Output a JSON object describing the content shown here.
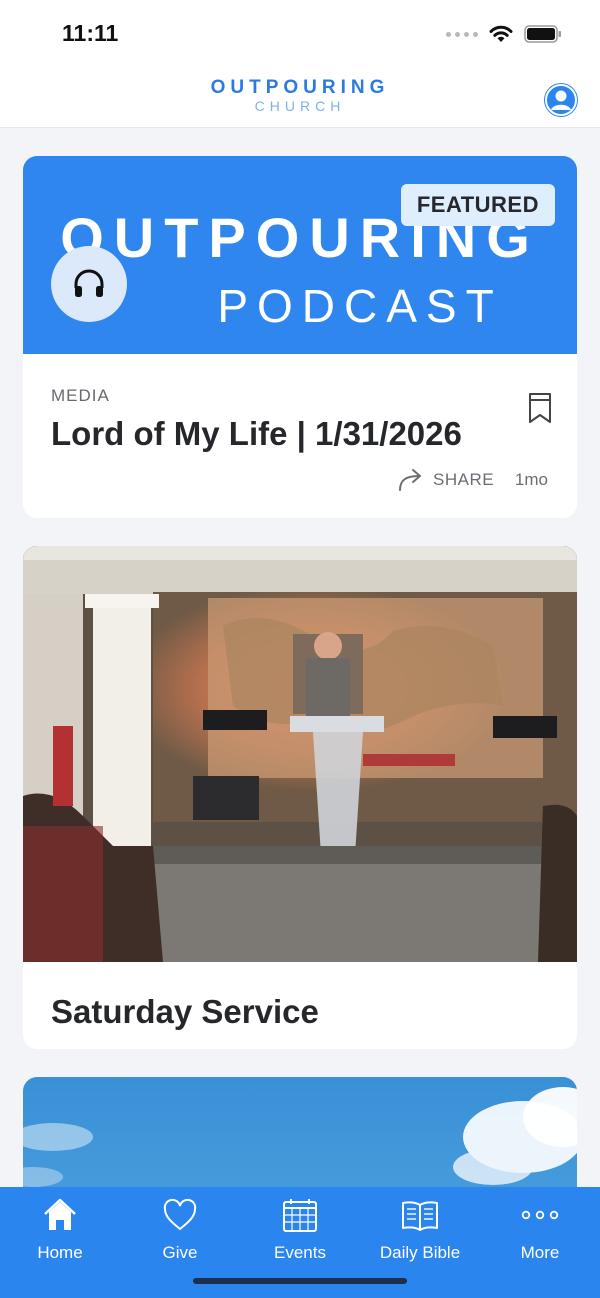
{
  "status_bar": {
    "time": "11:11"
  },
  "header": {
    "logo_top": "OUTPOURING",
    "logo_bottom": "CHURCH",
    "profile_icon": "person-icon"
  },
  "featured_card": {
    "banner_line_1": "OUTPOURING",
    "banner_line_2": "PODCAST",
    "badge": "FEATURED",
    "category": "MEDIA",
    "title": "Lord of My Life | 1/31/2026",
    "share_label": "SHARE",
    "time_ago": "1mo",
    "icons": [
      "headphones-icon",
      "bookmark-icon",
      "share-arrow-icon"
    ]
  },
  "service_card": {
    "title": "Saturday Service"
  },
  "tab_bar": {
    "items": [
      {
        "label": "Home",
        "icon": "home-icon"
      },
      {
        "label": "Give",
        "icon": "heart-icon"
      },
      {
        "label": "Events",
        "icon": "calendar-icon"
      },
      {
        "label": "Daily Bible",
        "icon": "book-icon"
      },
      {
        "label": "More",
        "icon": "more-dots-icon"
      }
    ]
  },
  "colors": {
    "brand_blue": "#2b85ee",
    "banner_blue": "#2e86ee",
    "badge_bg": "#dfeefd",
    "background": "#f2f4f8"
  }
}
